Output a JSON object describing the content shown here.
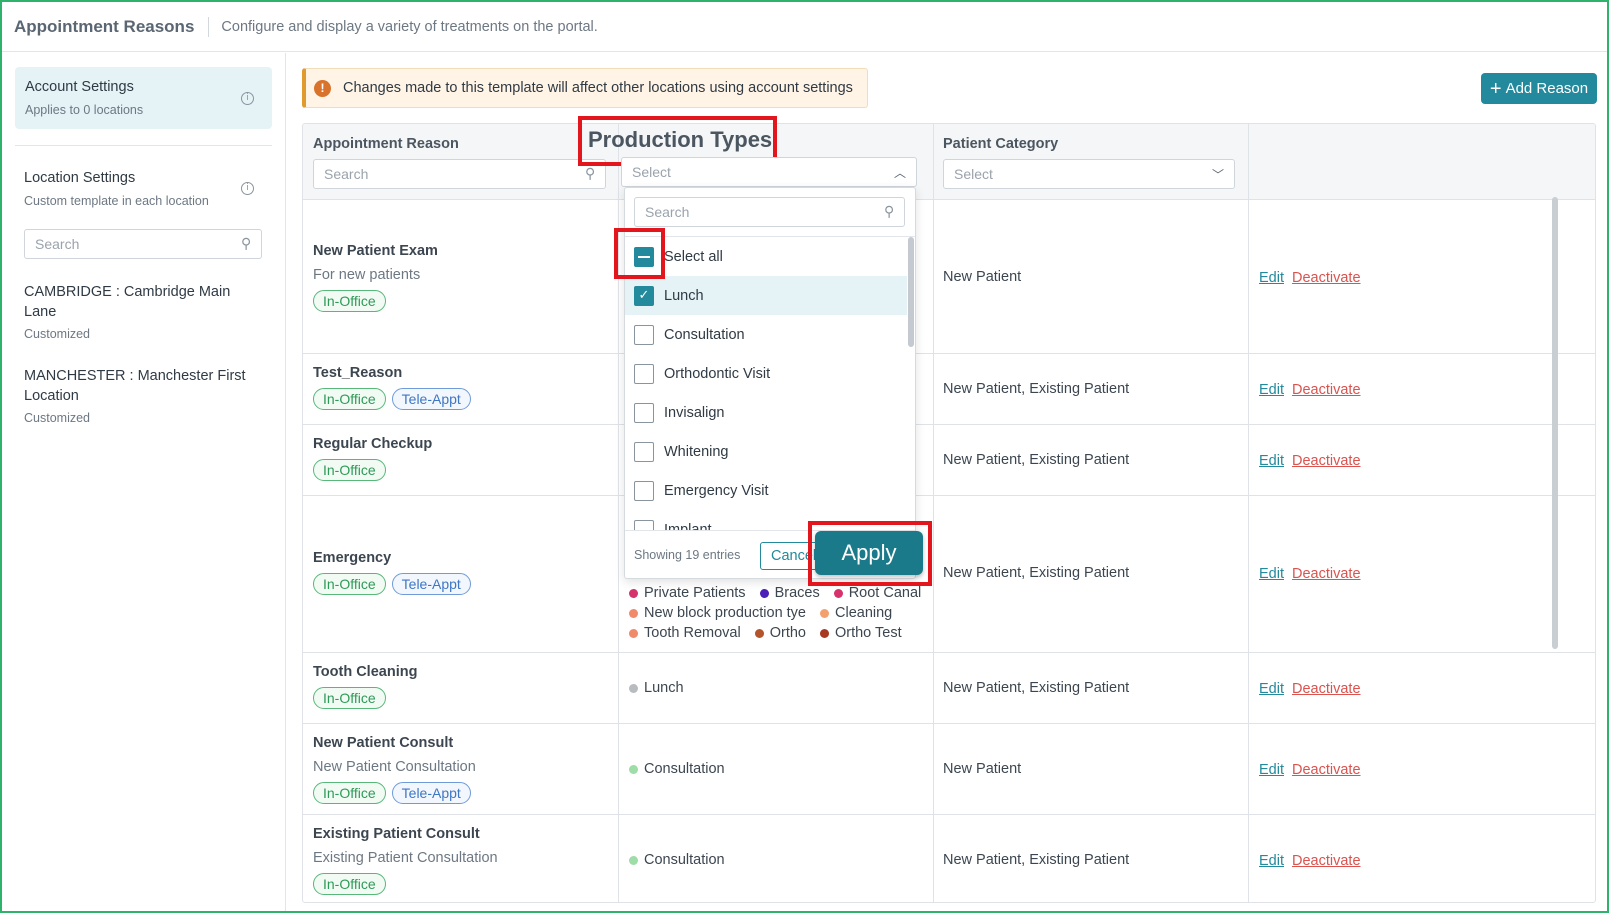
{
  "header": {
    "title": "Appointment Reasons",
    "subtitle": "Configure and display a variety of treatments on the portal."
  },
  "sidebar": {
    "account": {
      "title": "Account Settings",
      "subtitle": "Applies to 0 locations"
    },
    "location": {
      "title": "Location Settings",
      "subtitle": "Custom template in each location"
    },
    "search_placeholder": "Search",
    "locations": [
      {
        "name": "CAMBRIDGE : Cambridge Main Lane",
        "status": "Customized"
      },
      {
        "name": "MANCHESTER : Manchester First Location",
        "status": "Customized"
      }
    ]
  },
  "main": {
    "warning": "Changes made to this template will affect other locations using account settings",
    "add_button": "Add Reason"
  },
  "table": {
    "columns": {
      "reason": "Appointment Reason",
      "production": "Production Types",
      "category": "Patient Category"
    },
    "reason_search_placeholder": "Search",
    "select_placeholder": "Select",
    "tag_labels": {
      "office": "In-Office",
      "tele": "Tele-Appt"
    },
    "actions": {
      "edit": "Edit",
      "deactivate": "Deactivate"
    },
    "rows": [
      {
        "name": "New Patient Exam",
        "desc": "For new patients",
        "category": "New Patient"
      },
      {
        "name": "Test_Reason",
        "desc": "",
        "category": "New Patient, Existing Patient"
      },
      {
        "name": "Regular Checkup",
        "desc": "",
        "category": "New Patient, Existing Patient"
      },
      {
        "name": "Emergency",
        "desc": "",
        "category": "New Patient, Existing Patient"
      },
      {
        "name": "Tooth Cleaning",
        "desc": "",
        "category": "New Patient, Existing Patient"
      },
      {
        "name": "New Patient Consult",
        "desc": "New Patient Consultation",
        "category": "New Patient"
      },
      {
        "name": "Existing Patient Consult",
        "desc": "Existing Patient Consultation",
        "category": "New Patient, Existing Patient"
      }
    ],
    "production_lines": {
      "emergency": [
        "Private Patients",
        "Braces",
        "Root Canal",
        "New block production tye",
        "Cleaning",
        "Tooth Removal",
        "Ortho",
        "Ortho Test"
      ],
      "tooth_cleaning": "Lunch",
      "new_consult": "Consultation",
      "existing_consult": "Consultation"
    },
    "dot_colors": {
      "private": "#d6336c",
      "braces": "#4c1fb8",
      "root": "#d6336c",
      "block": "#f08a6a",
      "cleaning": "#f3a06e",
      "removal": "#f08a6a",
      "ortho": "#b5532b",
      "orthotest": "#a83a22",
      "lunch": "#b8bcc0",
      "consult": "#9edca8"
    }
  },
  "dropdown": {
    "search_placeholder": "Search",
    "select_all": "Select all",
    "items": [
      {
        "label": "Lunch",
        "checked": true
      },
      {
        "label": "Consultation",
        "checked": false
      },
      {
        "label": "Orthodontic Visit",
        "checked": false
      },
      {
        "label": "Invisalign",
        "checked": false
      },
      {
        "label": "Whitening",
        "checked": false
      },
      {
        "label": "Emergency Visit",
        "checked": false
      },
      {
        "label": "Implant",
        "checked": false
      }
    ],
    "count": "Showing 19 entries",
    "cancel": "Cancel",
    "apply": "Apply"
  },
  "colors": {
    "accent": "#23899c",
    "highlight": "#e3161d",
    "danger": "#d9534f"
  }
}
